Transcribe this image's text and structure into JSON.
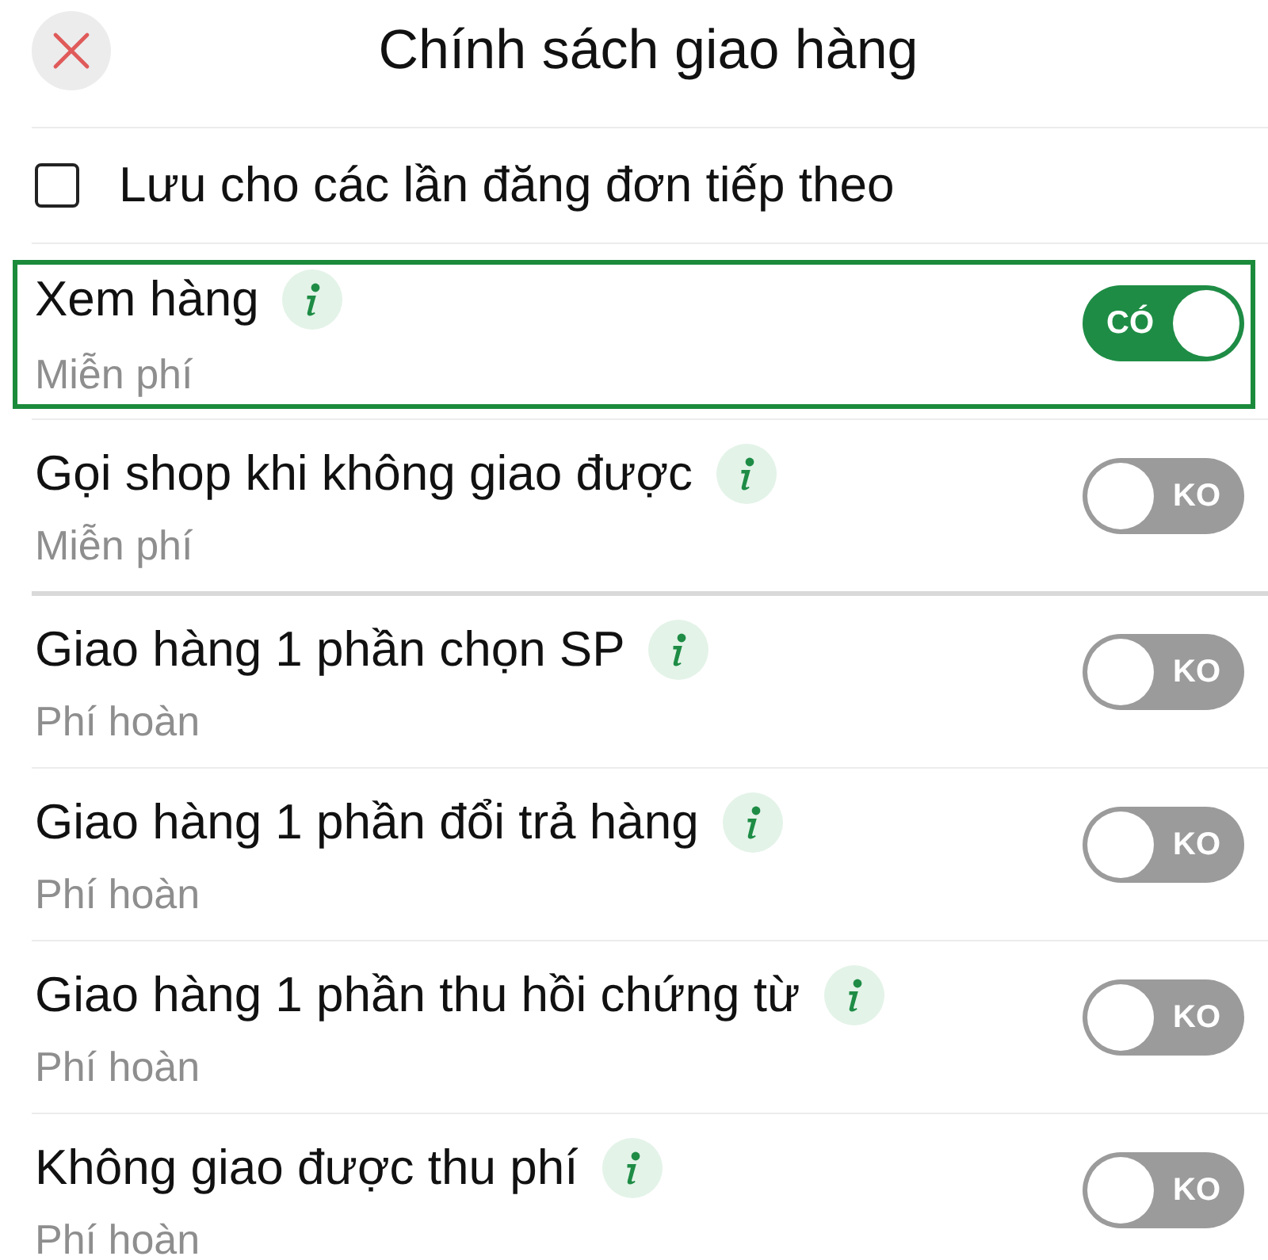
{
  "header": {
    "title": "Chính sách giao hàng"
  },
  "remember": {
    "label": "Lưu cho các lần đăng đơn tiếp theo",
    "checked": false
  },
  "sections": [
    {
      "options": [
        {
          "title": "Xem hàng",
          "fee": "Miễn phí",
          "highlighted": true,
          "on": true,
          "toggle_label": "CÓ"
        },
        {
          "title": "Gọi shop khi không giao được",
          "fee": "Miễn phí",
          "highlighted": false,
          "on": false,
          "toggle_label": "KO"
        }
      ]
    },
    {
      "options": [
        {
          "title": "Giao hàng 1 phần chọn SP",
          "fee": "Phí hoàn",
          "highlighted": false,
          "on": false,
          "toggle_label": "KO"
        },
        {
          "title": "Giao hàng 1 phần đổi trả hàng",
          "fee": "Phí hoàn",
          "highlighted": false,
          "on": false,
          "toggle_label": "KO"
        },
        {
          "title": "Giao hàng 1 phần thu hồi chứng từ",
          "fee": "Phí hoàn",
          "highlighted": false,
          "on": false,
          "toggle_label": "KO"
        },
        {
          "title": "Không giao được thu phí",
          "fee": "Phí hoàn",
          "highlighted": false,
          "on": false,
          "toggle_label": "KO"
        }
      ]
    }
  ]
}
